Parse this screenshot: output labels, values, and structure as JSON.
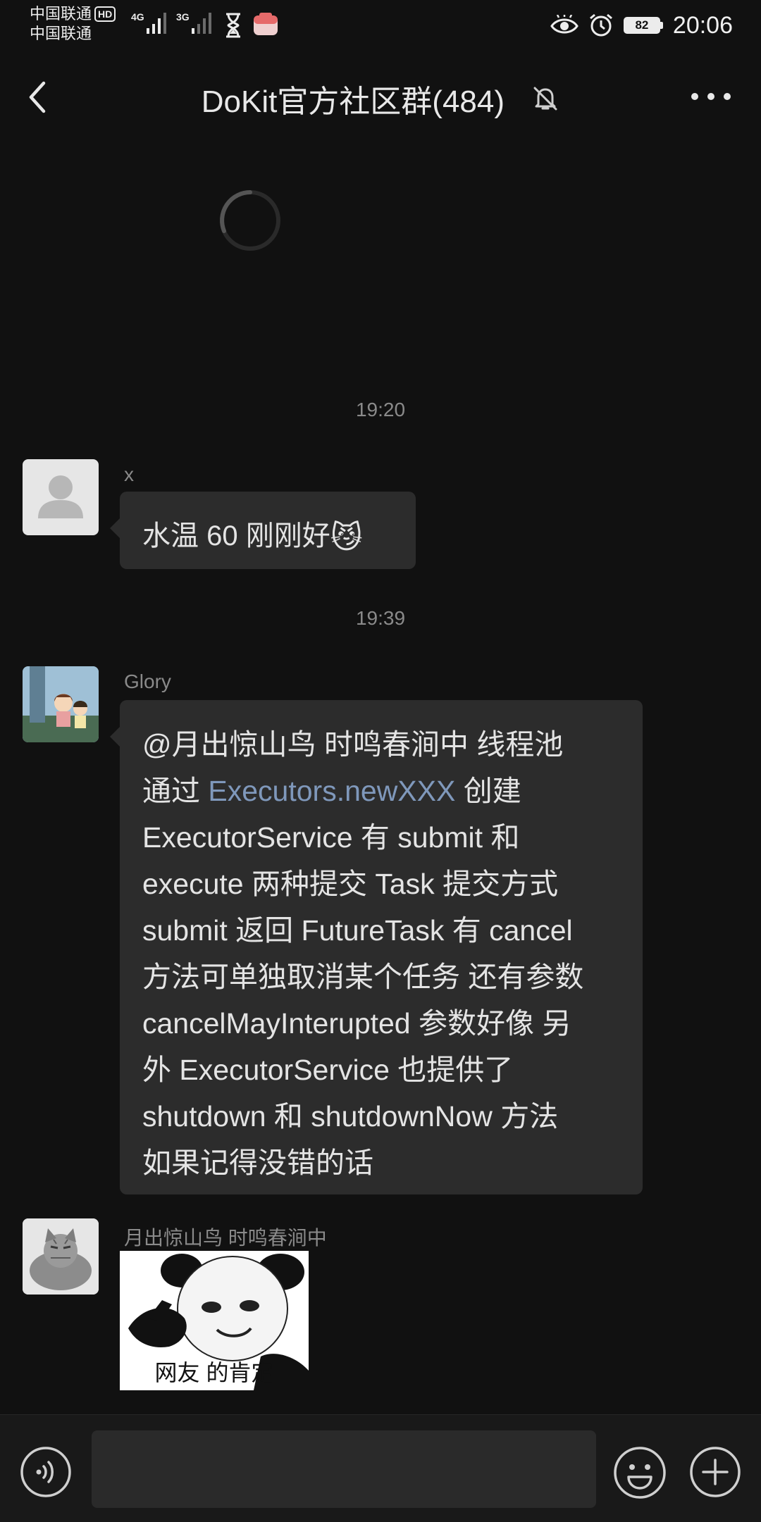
{
  "status_bar": {
    "carrier_1": "中国联通",
    "hd_badge": "HD",
    "carrier_2": "中国联通",
    "net_1": "4G",
    "net_2": "3G",
    "battery": "82",
    "time": "20:06",
    "icons": [
      "signal-bars-icon",
      "hourglass-icon",
      "app-notification-icon",
      "eye-icon",
      "alarm-clock-icon",
      "battery-icon"
    ]
  },
  "header": {
    "title": "DoKit官方社区群(484)",
    "icons": [
      "back-arrow-icon",
      "mute-bell-icon",
      "more-dots-icon"
    ]
  },
  "messages": [
    {
      "type": "time",
      "text": "19:20"
    },
    {
      "type": "text",
      "sender": "x",
      "text": "水温 60 刚刚好",
      "emoji": "😼"
    },
    {
      "type": "time",
      "text": "19:39"
    },
    {
      "type": "text",
      "sender": "Glory",
      "lines": [
        "@月出惊山鸟  时鸣春涧中   线程池",
        "通过 ",
        "Executors.newXXX",
        " 创建",
        "ExecutorService 有 submit 和",
        "execute 两种提交 Task 提交方式",
        "submit 返回 FutureTask 有 cancel",
        "方法可单独取消某个任务 还有参数",
        "cancelMayInterupted 参数好像 另",
        "外 ExecutorService 也提供了",
        "shutdown 和 shutdownNow 方法",
        "如果记得没错的话"
      ]
    },
    {
      "type": "sticker",
      "sender": "月出惊山鸟  时鸣春涧中",
      "caption": "网友 的肯定"
    }
  ],
  "input_bar": {
    "placeholder": "",
    "icons": [
      "voice-icon",
      "emoji-icon",
      "plus-icon"
    ]
  },
  "colors": {
    "background": "#111111",
    "bubble": "#2c2c2c",
    "link": "#7f98bb",
    "muted_text": "#8a8a8a"
  }
}
